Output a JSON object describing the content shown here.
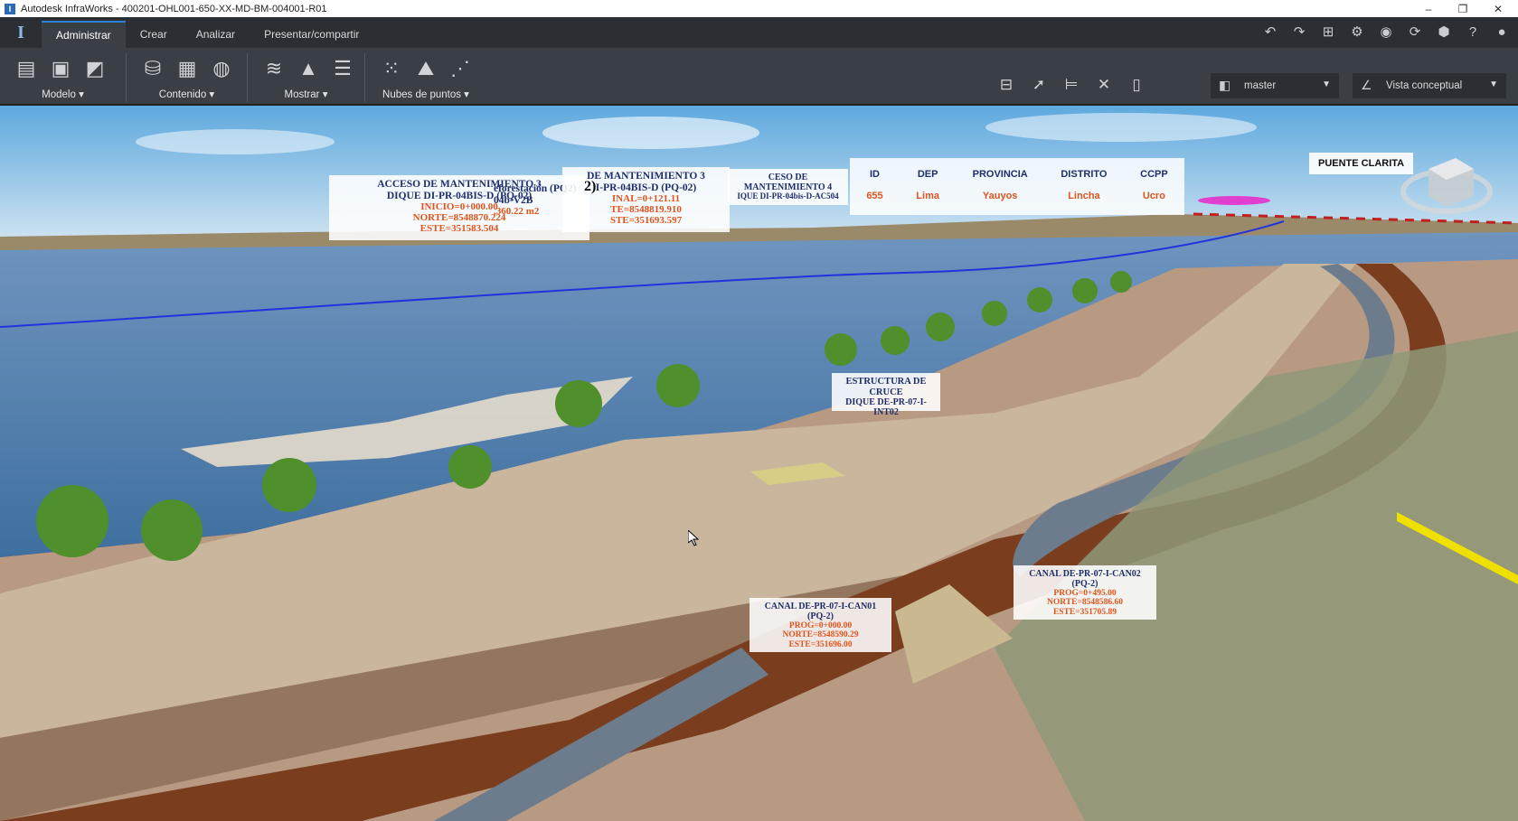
{
  "window": {
    "title": "Autodesk InfraWorks - 400201-OHL001-650-XX-MD-BM-004001-R01",
    "controls": [
      "–",
      "❐",
      "✕"
    ]
  },
  "tabs": [
    {
      "label": "Administrar",
      "active": true
    },
    {
      "label": "Crear",
      "active": false
    },
    {
      "label": "Analizar",
      "active": false
    },
    {
      "label": "Presentar/compartir",
      "active": false
    }
  ],
  "ribbon": {
    "groups": [
      {
        "label": "Modelo",
        "icons": [
          "model-explorer-icon",
          "model-properties-icon",
          "map-icon"
        ]
      },
      {
        "label": "Contenido",
        "icons": [
          "data-sources-icon",
          "grid-icon",
          "globe-icon"
        ]
      },
      {
        "label": "Mostrar",
        "icons": [
          "layers-icon",
          "terrain-icon",
          "list-icon"
        ]
      },
      {
        "label": "Nubes de puntos",
        "icons": [
          "point-cloud-icon",
          "point-cloud-terrain-icon",
          "point-cloud-edit-icon"
        ]
      }
    ]
  },
  "view": {
    "proposal": "master",
    "style": "Vista conceptual"
  },
  "labels": {
    "acceso3": {
      "title1": "ACCESO DE MANTENIMIENTO 3",
      "title2": "DIQUE DI-PR-04BIS-D (PQ-02)",
      "l1": "INICIO=0+000.00",
      "l2": "NORTE=8548870.224",
      "l3": "ESTE=351583.504"
    },
    "reforest": {
      "title1": "eforestación (PQ2)",
      "title2": "04b-V2B",
      "l1": ",360.22 m2",
      "tag": "2)"
    },
    "acceso3b": {
      "title1": "DE MANTENIMIENTO 3",
      "title2": "I-PR-04BIS-D (PQ-02)",
      "l1": "INAL=0+121.11",
      "l2": "TE=8548819.910",
      "l3": "STE=351693.597"
    },
    "acceso4": {
      "title1": "CESO DE MANTENIMIENTO 4",
      "title2": "IQUE DI-PR-04bis-D-AC504"
    },
    "estructura": {
      "title1": "ESTRUCTURA DE CRUCE",
      "title2": "DIQUE DE-PR-07-I-INT02"
    },
    "canal01": {
      "title1": "CANAL DE-PR-07-I-CAN01 (PQ-2)",
      "l1": "PROG=0+000.00",
      "l2": "NORTE=8548590.29",
      "l3": "ESTE=351696.00"
    },
    "canal02": {
      "title1": "CANAL DE-PR-07-I-CAN02 (PQ-2)",
      "l1": "PROG=0+495.00",
      "l2": "NORTE=8548586.60",
      "l3": "ESTE=351705.89"
    }
  },
  "info_table": {
    "columns": [
      {
        "header": "ID",
        "value": "655"
      },
      {
        "header": "DEP",
        "value": "Lima"
      },
      {
        "header": "PROVINCIA",
        "value": "Yauyos"
      },
      {
        "header": "DISTRITO",
        "value": "Lincha"
      },
      {
        "header": "CCPP",
        "value": "Ucro"
      }
    ]
  },
  "puente": "PUENTE CLARITA",
  "colors": {
    "accent": "#2f7fd6",
    "label_title": "#1f2d6b",
    "label_value": "#e0531c",
    "water": "#4f7fae",
    "dike": "#b89a82",
    "channel": "#7a3e1f"
  }
}
